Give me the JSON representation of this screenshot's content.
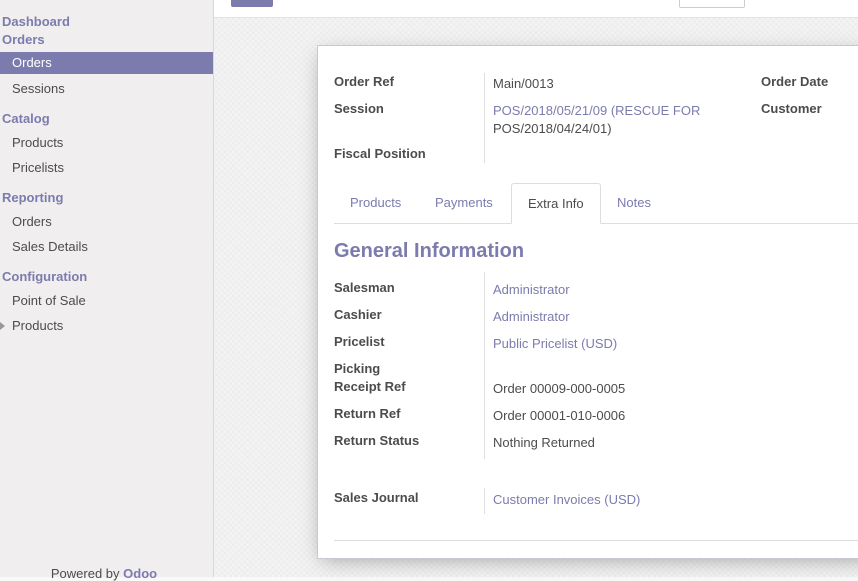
{
  "sidebar": {
    "dashboard": "Dashboard",
    "orders_header": "Orders",
    "orders_item": "Orders",
    "sessions_item": "Sessions",
    "catalog_header": "Catalog",
    "products_item": "Products",
    "pricelists_item": "Pricelists",
    "reporting_header": "Reporting",
    "reporting_orders_item": "Orders",
    "sales_details_item": "Sales Details",
    "configuration_header": "Configuration",
    "point_of_sale_item": "Point of Sale",
    "config_products_item": "Products",
    "powered_by": "Powered by",
    "brand": "Odoo"
  },
  "header": {
    "order_ref_label": "Order Ref",
    "order_ref_value": "Main/0013",
    "session_label": "Session",
    "session_value_line1": "POS/2018/05/21/09 (RESCUE FOR",
    "session_value_line2": "POS/2018/04/24/01)",
    "fiscal_position_label": "Fiscal Position",
    "order_date_label": "Order Date",
    "customer_label": "Customer"
  },
  "tabs": [
    "Products",
    "Payments",
    "Extra Info",
    "Notes"
  ],
  "active_tab": "Extra Info",
  "extra_info": {
    "section_title": "General Information",
    "salesman_label": "Salesman",
    "salesman_value": "Administrator",
    "cashier_label": "Cashier",
    "cashier_value": "Administrator",
    "pricelist_label": "Pricelist",
    "pricelist_value": "Public Pricelist (USD)",
    "picking_label": "Picking",
    "receipt_ref_label": "Receipt Ref",
    "receipt_ref_value": "Order 00009-000-0005",
    "return_ref_label": "Return Ref",
    "return_ref_value": "Order 00001-010-0006",
    "return_status_label": "Return Status",
    "return_status_value": "Nothing Returned",
    "sales_journal_label": "Sales Journal",
    "sales_journal_value": "Customer Invoices (USD)"
  },
  "colors": {
    "accent": "#7c7bad",
    "text": "#4c4c4c",
    "sidebar_bg": "#f0eeee"
  }
}
